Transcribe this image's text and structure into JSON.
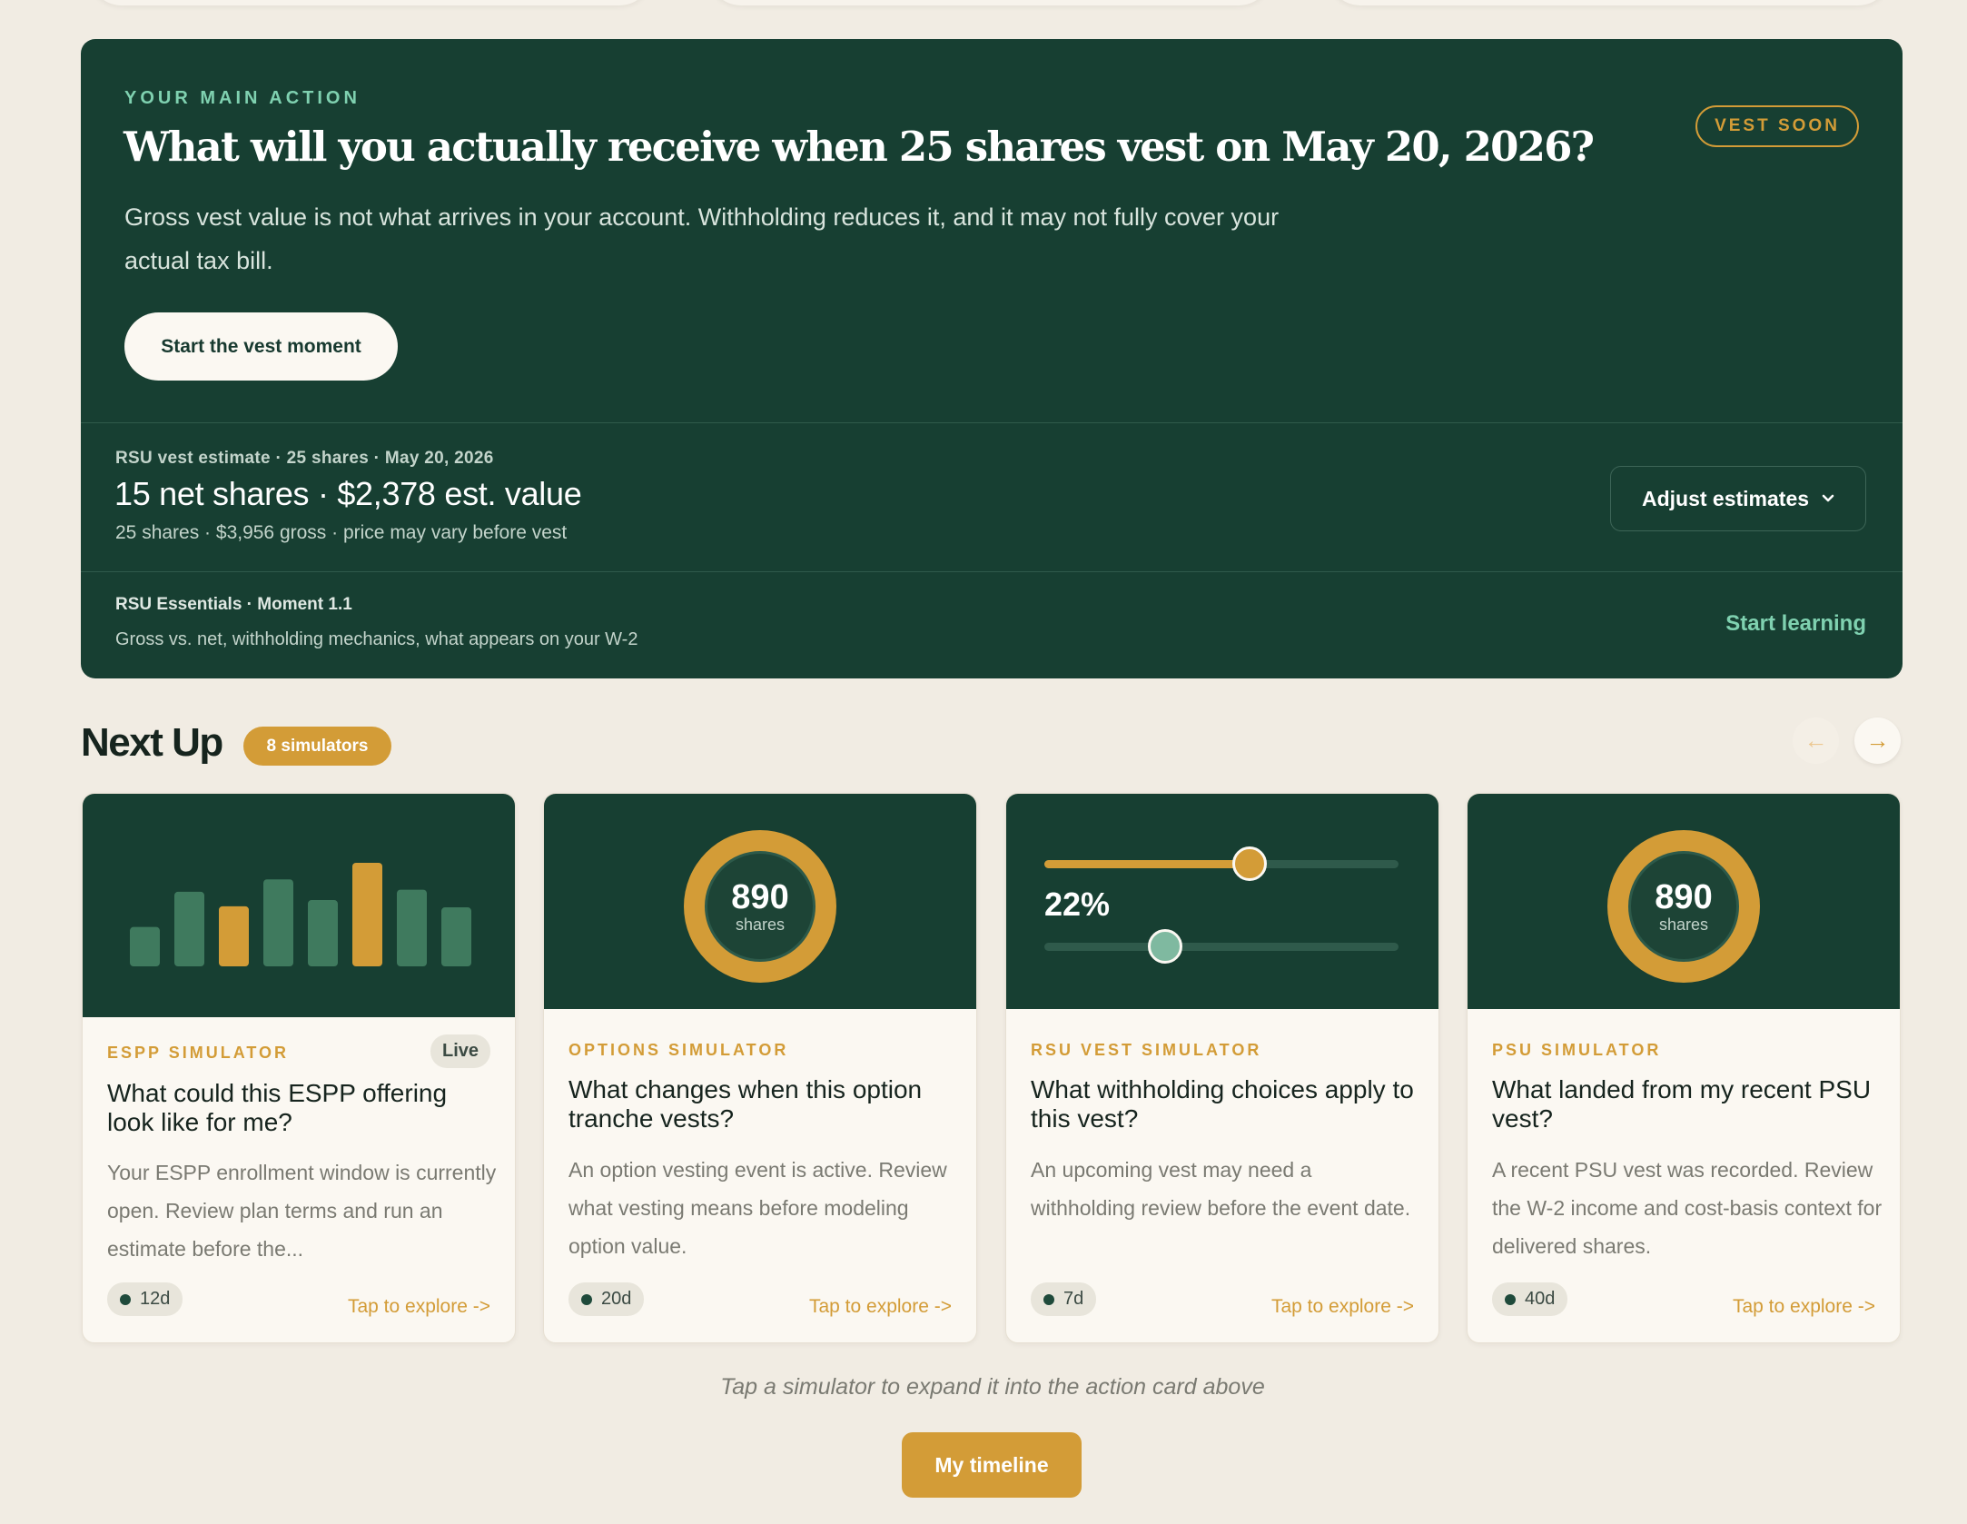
{
  "main_action": {
    "eyebrow": "YOUR MAIN ACTION",
    "title": "What will you actually receive when 25 shares vest on May 20, 2026?",
    "badge": "VEST SOON",
    "description": "Gross vest value is not what arrives in your account. Withholding reduces it, and it may not fully cover your actual tax bill.",
    "cta_label": "Start the vest moment",
    "estimate": {
      "label": "RSU vest estimate · 25 shares · May 20, 2026",
      "value": "15 net shares · $2,378 est. value",
      "sub": "25 shares · $3,956 gross · price may vary before vest",
      "adjust_label": "Adjust estimates",
      "adjust_icon": "chevron-down-icon"
    },
    "learning": {
      "label": "RSU Essentials · Moment 1.1",
      "sub": "Gross vs. net, withholding mechanics, what appears on your W-2",
      "link": "Start learning"
    }
  },
  "next_up": {
    "title": "Next Up",
    "count_badge": "8 simulators",
    "prev_icon": "arrow-left-icon",
    "next_icon": "arrow-right-icon",
    "cards": [
      {
        "eyebrow": "ESPP SIMULATOR",
        "badge": "Live",
        "title": "What could this ESPP offering look like for me?",
        "description": "Your ESPP enrollment window is currently open. Review plan terms and run an estimate before the...",
        "days": "12d",
        "cta": "Tap to explore ->",
        "bars": [
          0.38,
          0.72,
          0.58,
          0.84,
          0.64,
          1.0,
          0.74,
          0.57
        ],
        "highlight_bars": [
          2,
          5
        ]
      },
      {
        "eyebrow": "OPTIONS SIMULATOR",
        "title": "What changes when this option tranche vests?",
        "description": "An option vesting event is active. Review what vesting means before modeling option value.",
        "days": "20d",
        "cta": "Tap to explore ->",
        "ring_value": "890",
        "ring_unit": "shares"
      },
      {
        "eyebrow": "RSU VEST SIMULATOR",
        "title": "What withholding choices apply to this vest?",
        "description": "An upcoming vest may need a withholding review before the event date.",
        "days": "7d",
        "cta": "Tap to explore ->",
        "slider_value": "22%",
        "slider_top_fraction": 0.58,
        "slider_bottom_fraction": 0.34
      },
      {
        "eyebrow": "PSU SIMULATOR",
        "title": "What landed from my recent PSU vest?",
        "description": "A recent PSU vest was recorded. Review the W-2 income and cost-basis context for delivered shares.",
        "days": "40d",
        "cta": "Tap to explore ->",
        "ring_value": "890",
        "ring_unit": "shares"
      }
    ]
  },
  "hint": "Tap a simulator to expand it into the action card above",
  "timeline_button": "My timeline",
  "colors": {
    "background": "#f1ece3",
    "dark_green": "#173f32",
    "accent_gold": "#d39c37",
    "mint": "#7fd1b0",
    "bar_green": "#3f7a5e"
  }
}
